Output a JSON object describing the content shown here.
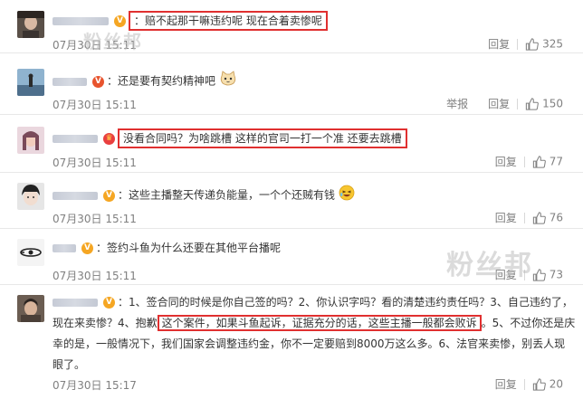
{
  "watermark": "粉丝邦",
  "actions": {
    "reply": "回复",
    "report": "举报"
  },
  "comments": [
    {
      "text": "：赔不起那干嘛违约呢 现在合着卖惨呢",
      "time": "07月30日 15:11",
      "likes": "325",
      "badge": "V"
    },
    {
      "text": "：还是要有契约精神吧",
      "time": "07月30日 15:11",
      "likes": "150",
      "badge": "V"
    },
    {
      "text": "没看合同吗？为啥跳槽 这样的官司一打一个准 还要去跳槽",
      "time": "07月30日 15:11",
      "likes": "77",
      "badge": "crown"
    },
    {
      "text": "：这些主播整天传递负能量，一个个还贼有钱",
      "time": "07月30日 15:11",
      "likes": "76",
      "badge": "V"
    },
    {
      "text": "：签约斗鱼为什么还要在其他平台播呢",
      "time": "07月30日 15:11",
      "likes": "73",
      "badge": "V"
    },
    {
      "text_a": "：1、签合同的时候是你自己签的吗？2、你认识字吗？看的清楚违约责任吗？3、自己违约了，现在来卖惨？4、抱歉",
      "text_hl": "这个案件，如果斗鱼起诉，证据充分的话，这些主播一般都会败诉",
      "text_b": "。5、不过你还是庆幸的是，一般情况下，我们国家会调整违约金，你不一定要赔到8000万这么多。6、法官来卖惨，别丢人现眼了。",
      "time": "07月30日 15:17",
      "likes": "20",
      "badge": "V"
    }
  ]
}
